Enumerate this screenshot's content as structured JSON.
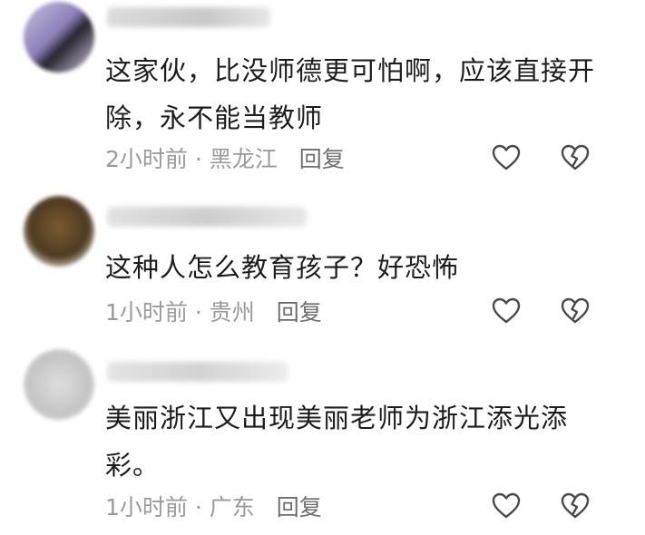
{
  "comments": [
    {
      "text": "这家伙，比没师德更可怕啊，应该直接开除，永不能当教师",
      "time": "2小时前",
      "location": "黑龙江",
      "reply_label": "回复"
    },
    {
      "text": "这种人怎么教育孩子？好恐怖",
      "time": "1小时前",
      "location": "贵州",
      "reply_label": "回复"
    },
    {
      "text": "美丽浙江又出现美丽老师为浙江添光添彩。",
      "time": "1小时前",
      "location": "广东",
      "reply_label": "回复"
    }
  ],
  "separator": " · ",
  "icons": {
    "like": "heart-icon",
    "dislike": "broken-heart-icon"
  }
}
